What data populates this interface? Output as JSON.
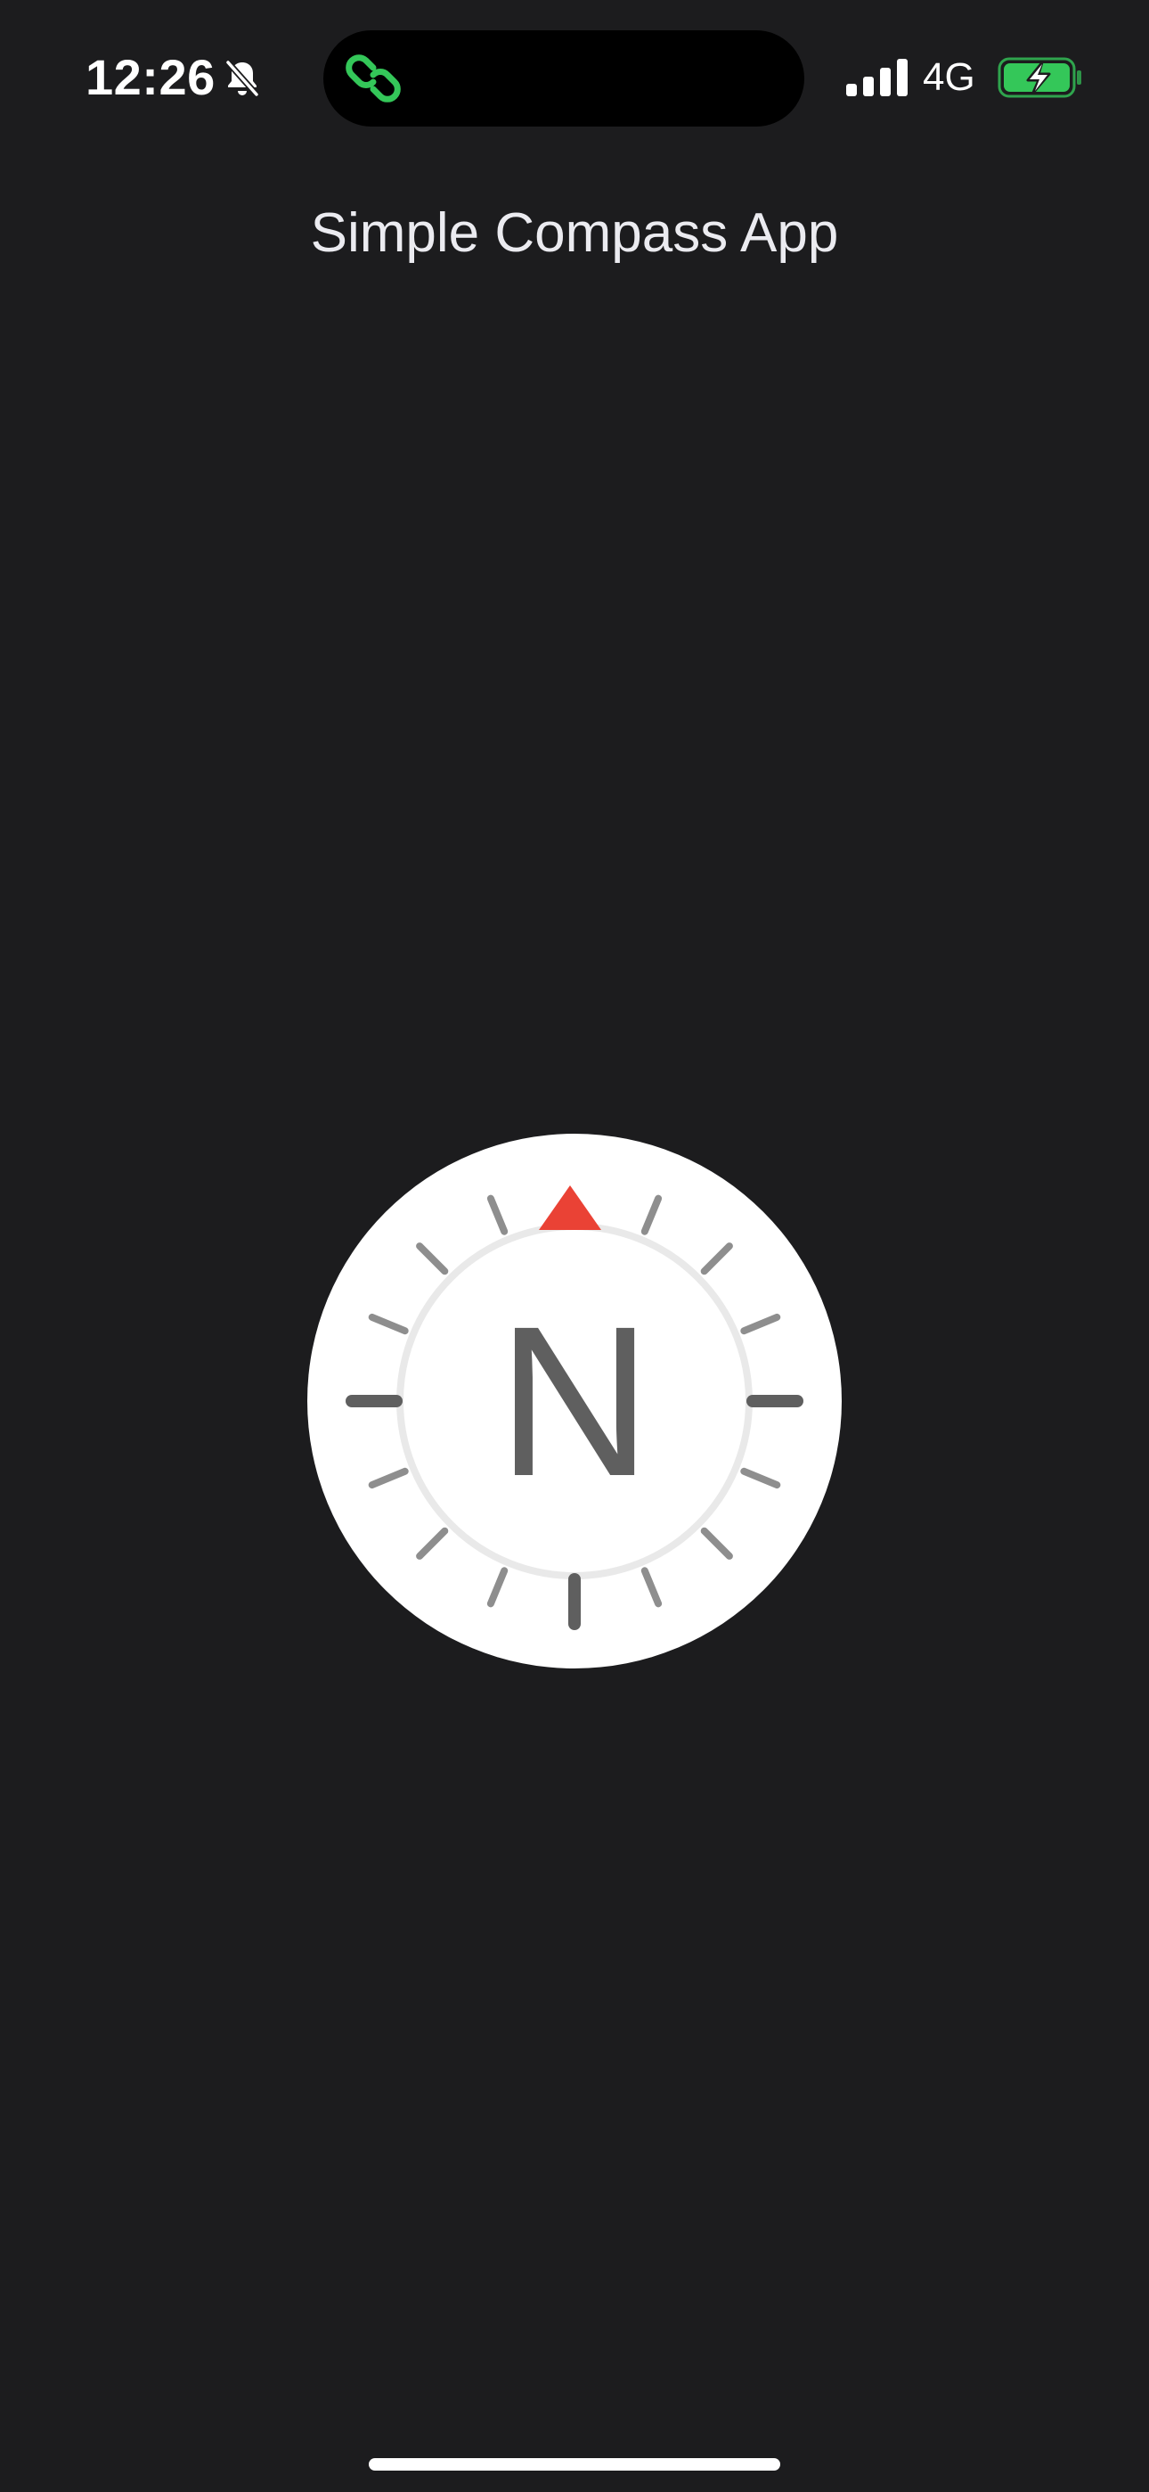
{
  "status_bar": {
    "time": "12:26",
    "bell_icon": "bell-slash-icon",
    "island_icon": "link-icon",
    "island_icon_color": "#34c759",
    "signal_icon": "cellular-signal-icon",
    "network": "4G",
    "battery_icon": "battery-charging-icon",
    "battery_color": "#34c759"
  },
  "header": {
    "title": "Simple Compass App"
  },
  "compass": {
    "heading_label": "N",
    "north_marker_icon": "red-triangle-icon",
    "north_marker_color": "#ea4235",
    "dial_color": "#ffffff",
    "major_tick_color": "#5f5f5f",
    "minor_tick_color": "#8e8e8e",
    "ring_color": "#e9e9e9"
  },
  "colors": {
    "background": "#1c1c1e",
    "text": "#ebebf0"
  }
}
